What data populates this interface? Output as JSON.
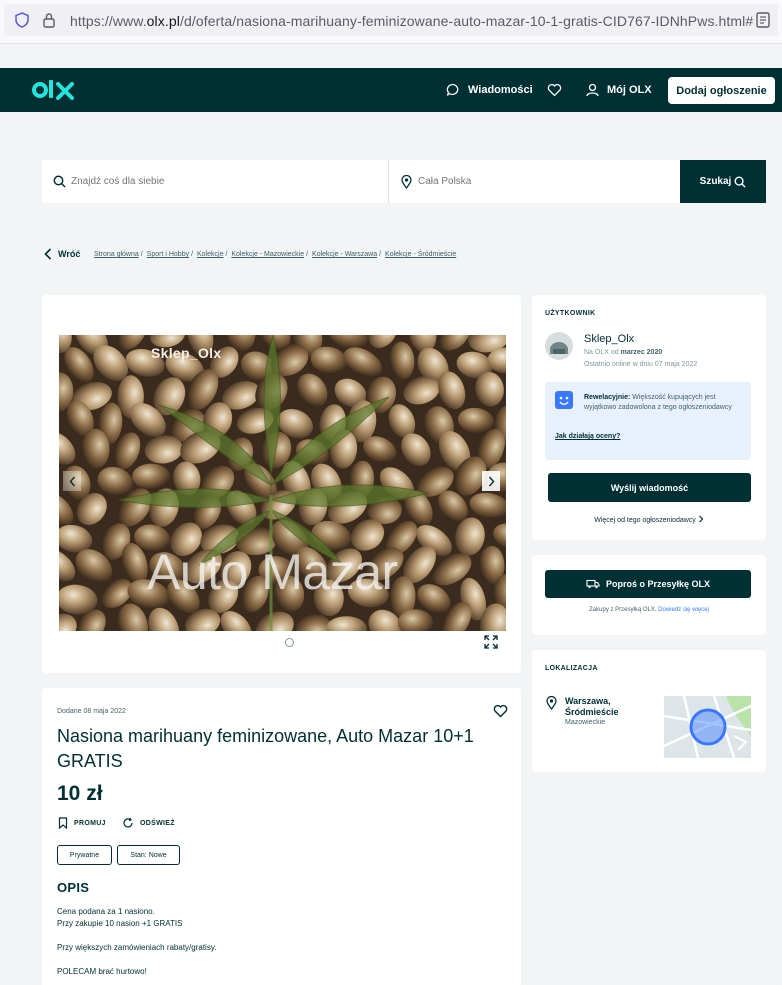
{
  "browser": {
    "url_prefix": "https://www.",
    "url_host": "olx.pl",
    "url_path": "/d/oferta/nasiona-marihuany-feminizowane-auto-mazar-10-1-gratis-CID767-IDNhPws.html#"
  },
  "header": {
    "logo": "olx",
    "messages_label": "Wiadomości",
    "my_olx_label": "Mój OLX",
    "add_listing_label": "Dodaj ogłoszenie"
  },
  "search": {
    "query_placeholder": "Znajdź coś dla siebie",
    "location_placeholder": "Cała Polska",
    "button_label": "Szukaj"
  },
  "breadcrumb": {
    "back_label": "Wróć",
    "items": [
      "Strona główna",
      "Sport i Hobby",
      "Kolekcje",
      "Kolekcje - Mazowieckie",
      "Kolekcje - Warszawa",
      "Kolekcje - Śródmieście"
    ]
  },
  "gallery": {
    "overlay_top": "Sklep_Olx",
    "overlay_big": "Auto Mazar"
  },
  "ad": {
    "date": "Dodane 08 maja 2022",
    "title": "Nasiona marihuany feminizowane, Auto Mazar 10+1 GRATIS",
    "price": "10 zł",
    "promote_label": "PROMUJ",
    "refresh_label": "ODŚWIEŻ",
    "tags": [
      "Prywatne",
      "Stan: Nowe"
    ],
    "description_heading": "OPIS",
    "description": {
      "line1": "Cena podana za 1 nasiono.",
      "line2": "Przy zakupie 10 nasion +1 GRATIS",
      "line3": "Przy większych zamówieniach rabaty/gratisy.",
      "line4": "POLECAM brać hurtowo!"
    }
  },
  "user": {
    "section_heading": "UŻYTKOWNIK",
    "name": "Sklep_Olx",
    "since_prefix": "Na OLX od",
    "since_value": "marzec 2020",
    "last_online": "Ostatnio online w dniu 07 maja 2022",
    "rating_bold": "Rewelacyjnie:",
    "rating_text": "Większość kupujących jest wyjątkowo zadowolona z tego ogłoszeniodawcy",
    "rating_link": "Jak działają oceny?",
    "send_message_label": "Wyślij wiadomość",
    "more_from_seller": "Więcej od tego ogłoszeniodawcy"
  },
  "shipping": {
    "button_label": "Poproś o Przesyłkę OLX",
    "text": "Zakupy z Przesyłką OLX.",
    "link": "Dowiedz się więcej"
  },
  "location": {
    "section_heading": "LOKALIZACJA",
    "city": "Warszawa, Śródmieście",
    "region": "Mazowieckie"
  },
  "colors": {
    "brand_dark": "#002f34",
    "accent_teal": "#23e5db",
    "link_blue": "#3a77ff"
  }
}
